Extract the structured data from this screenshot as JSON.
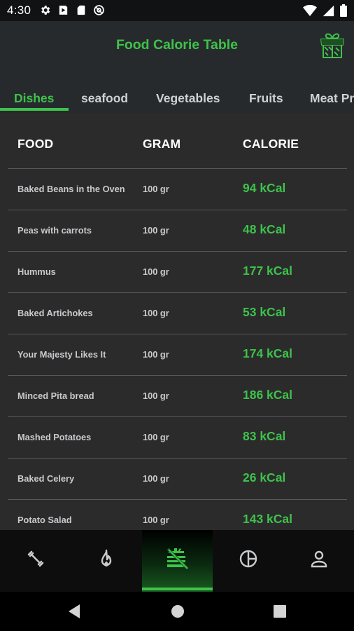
{
  "status_bar": {
    "time": "4:30",
    "left_icons": [
      "gear-icon",
      "play-icon",
      "sd-card-icon",
      "at-sign-icon"
    ],
    "right_icons": [
      "wifi-icon",
      "signal-icon",
      "battery-icon"
    ]
  },
  "header": {
    "title": "Food Calorie Table",
    "gift_icon": "gift-icon",
    "accent_color": "#3ec24b"
  },
  "tabs": [
    {
      "label": "Dishes",
      "active": true
    },
    {
      "label": "seafood",
      "active": false
    },
    {
      "label": "Vegetables",
      "active": false
    },
    {
      "label": "Fruits",
      "active": false
    },
    {
      "label": "Meat Pr",
      "active": false
    }
  ],
  "table": {
    "headers": {
      "food": "FOOD",
      "gram": "GRAM",
      "calorie": "CALORIE"
    },
    "rows": [
      {
        "food": "Baked Beans in the Oven",
        "gram": "100 gr",
        "calorie": "94 kCal"
      },
      {
        "food": "Peas with carrots",
        "gram": "100 gr",
        "calorie": "48 kCal"
      },
      {
        "food": "Hummus",
        "gram": "100 gr",
        "calorie": "177 kCal"
      },
      {
        "food": "Baked Artichokes",
        "gram": "100 gr",
        "calorie": "53 kCal"
      },
      {
        "food": "Your Majesty Likes It",
        "gram": "100 gr",
        "calorie": "174 kCal"
      },
      {
        "food": "Minced Pita bread",
        "gram": "100 gr",
        "calorie": "186 kCal"
      },
      {
        "food": "Mashed Potatoes",
        "gram": "100 gr",
        "calorie": "83 kCal"
      },
      {
        "food": "Baked Celery",
        "gram": "100 gr",
        "calorie": "26 kCal"
      },
      {
        "food": "Potato Salad",
        "gram": "100 gr",
        "calorie": "143 kCal"
      }
    ]
  },
  "bottom_nav": [
    {
      "icon": "dumbbell-icon",
      "active": false
    },
    {
      "icon": "flame-icon",
      "active": false
    },
    {
      "icon": "food-table-icon",
      "active": true
    },
    {
      "icon": "pie-chart-icon",
      "active": false
    },
    {
      "icon": "person-icon",
      "active": false
    }
  ],
  "system_nav": [
    "back-icon",
    "home-icon",
    "recents-icon"
  ]
}
